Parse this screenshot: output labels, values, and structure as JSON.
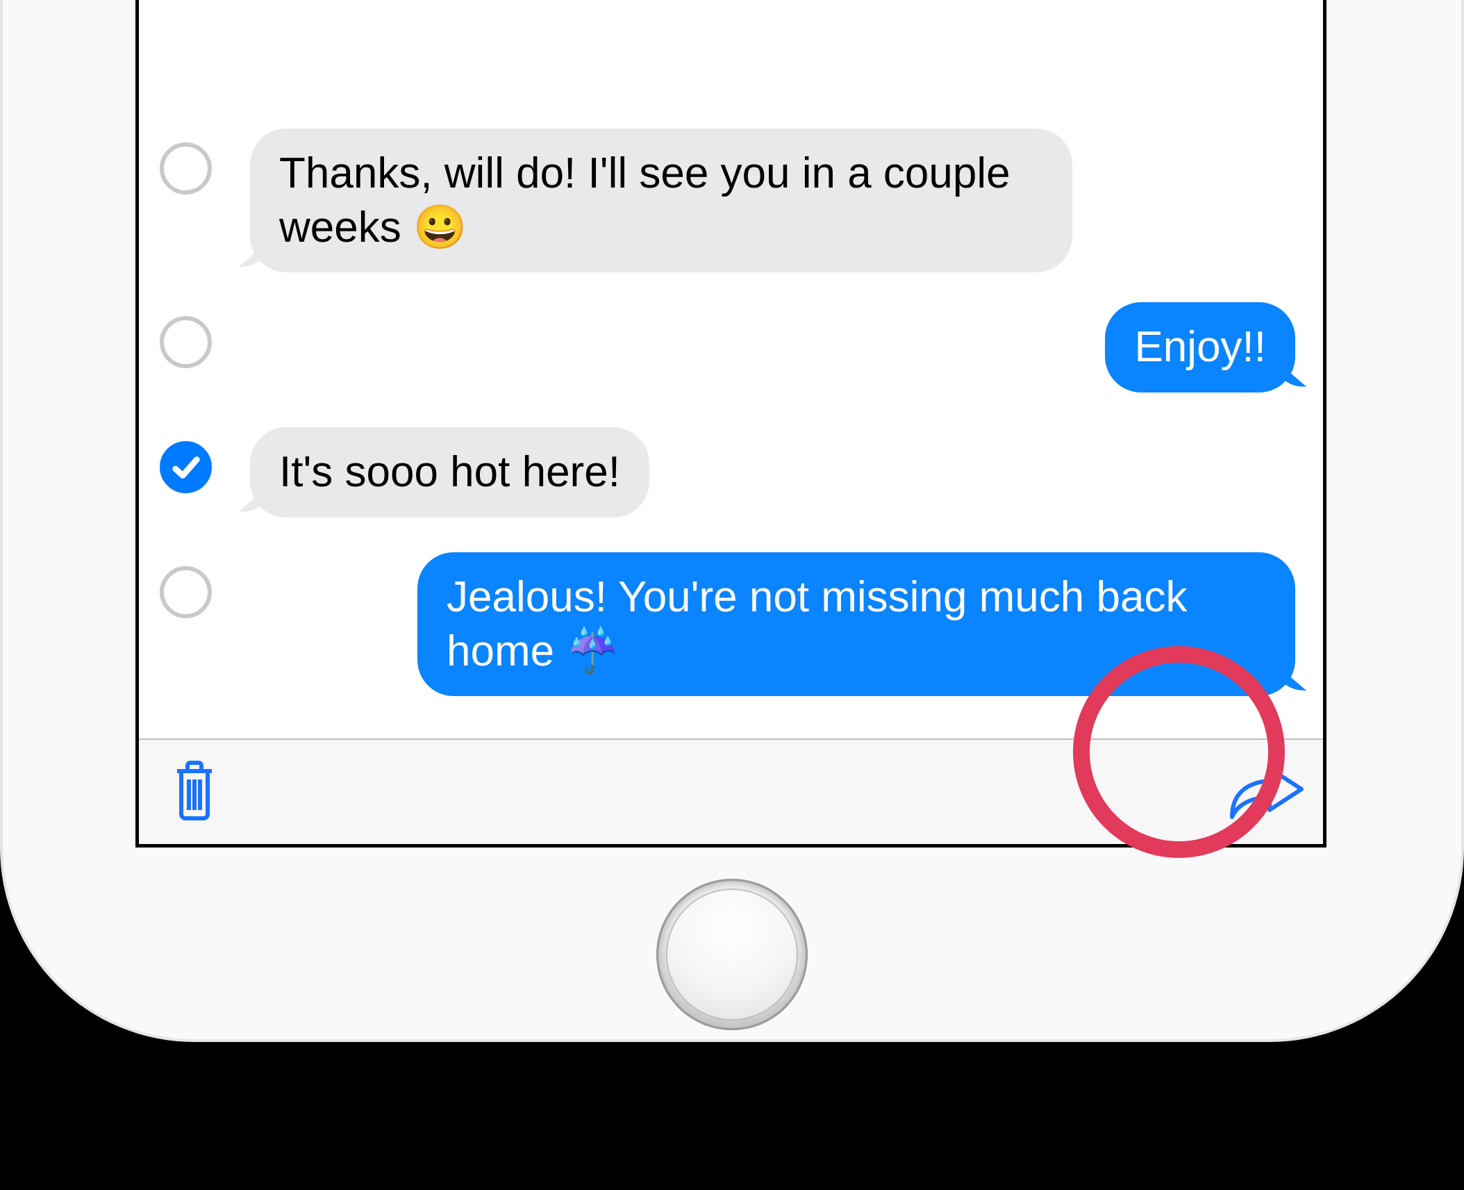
{
  "colors": {
    "accent": "#007aff",
    "bubble_in": "#e9e9eb",
    "bubble_out": "#0a84ff",
    "highlight_ring": "#e23a5a"
  },
  "messages": [
    {
      "side": "in",
      "selected": false,
      "text": "Thanks, will do! I'll see you in a couple weeks 😀"
    },
    {
      "side": "out",
      "selected": false,
      "text": "Enjoy!!"
    },
    {
      "side": "in",
      "selected": true,
      "text": "It's sooo hot here!"
    },
    {
      "side": "out",
      "selected": false,
      "text": "Jealous! You're not missing much back home ☔"
    }
  ],
  "toolbar": {
    "delete_icon": "trash-icon",
    "forward_icon": "forward-arrow-icon"
  },
  "annotation": {
    "highlighted": "forward-button"
  }
}
